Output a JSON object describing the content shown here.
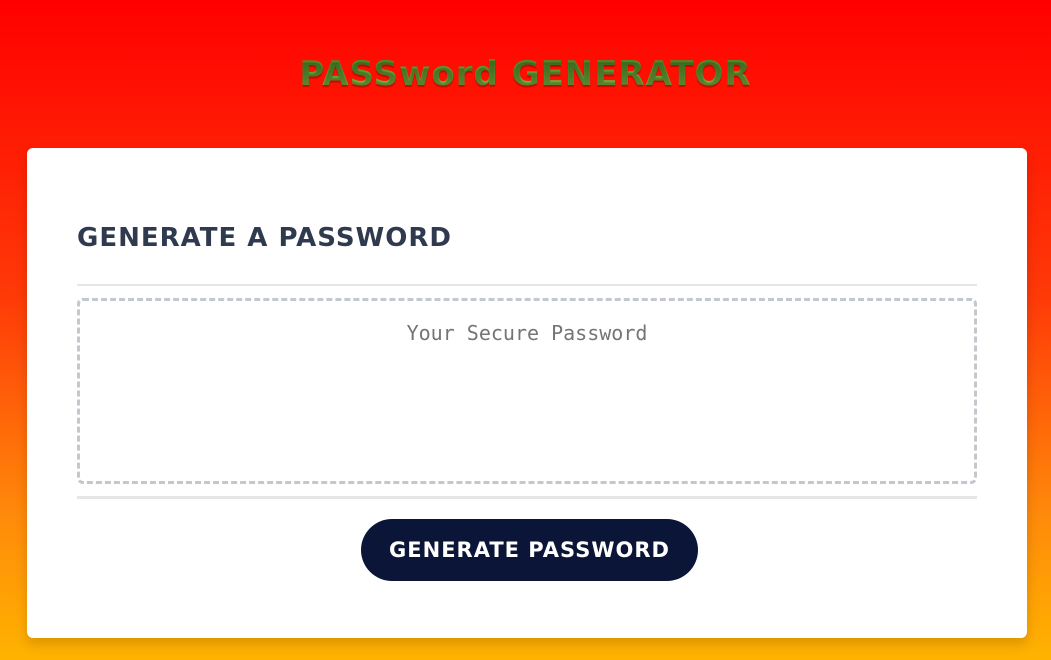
{
  "header": {
    "title": "PASSword GENERATOR"
  },
  "card": {
    "title": "GENERATE A PASSWORD",
    "password_placeholder": "Your Secure Password",
    "password_value": "",
    "generate_label": "GENERATE PASSWORD"
  },
  "colors": {
    "background_top": "#ff0000",
    "background_bottom": "#ffb300",
    "title_green": "#5fa33a",
    "card_title": "#2f3a4f",
    "button_bg": "#0b1538",
    "button_text": "#ffffff"
  }
}
